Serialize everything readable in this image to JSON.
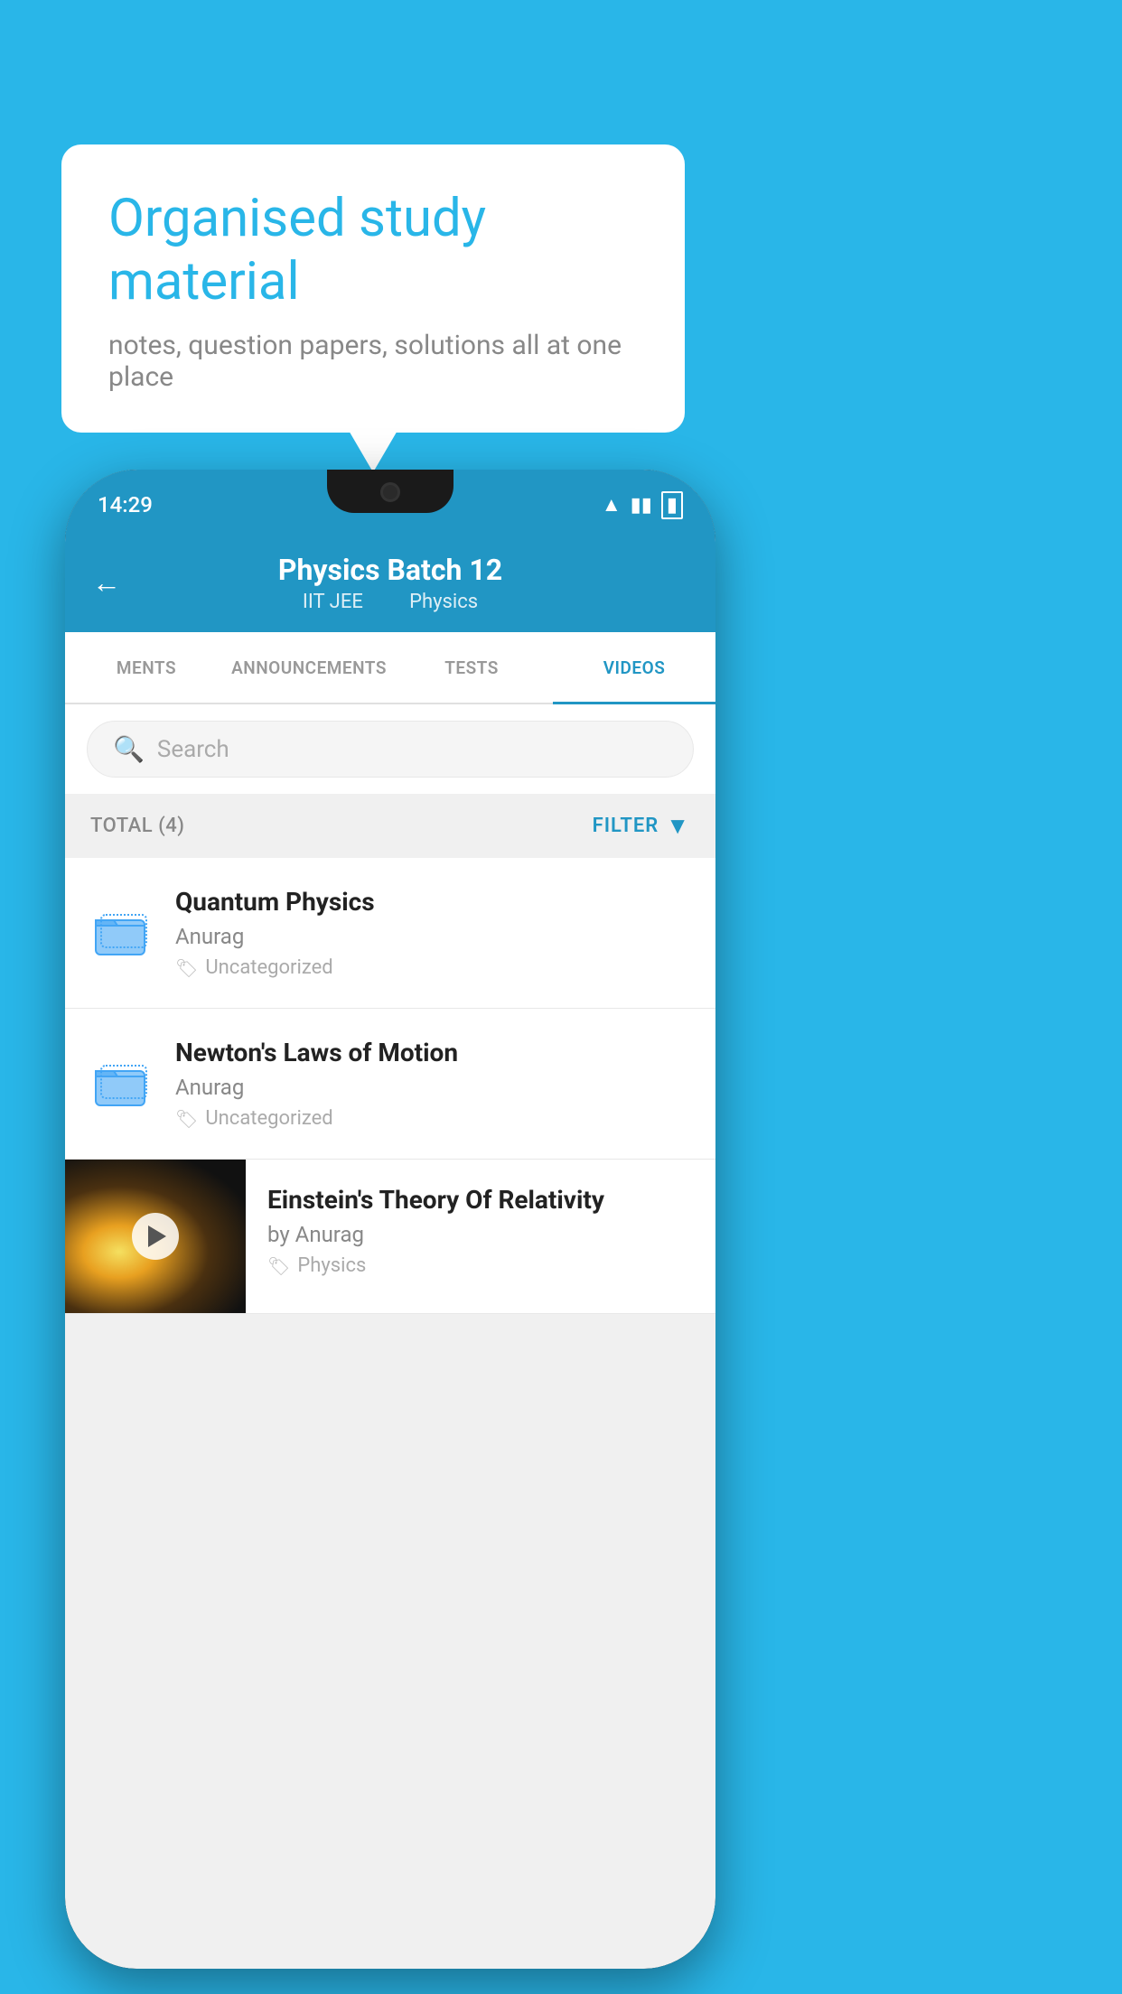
{
  "app": {
    "background_color": "#29b6e8"
  },
  "bubble": {
    "title": "Organised study material",
    "subtitle": "notes, question papers, solutions all at one place"
  },
  "status_bar": {
    "time": "14:29",
    "wifi": "▾",
    "signal": "▴",
    "battery": "▮"
  },
  "header": {
    "title": "Physics Batch 12",
    "subtitle1": "IIT JEE",
    "subtitle2": "Physics",
    "back_label": "←"
  },
  "tabs": [
    {
      "label": "MENTS",
      "active": false
    },
    {
      "label": "ANNOUNCEMENTS",
      "active": false
    },
    {
      "label": "TESTS",
      "active": false
    },
    {
      "label": "VIDEOS",
      "active": true
    }
  ],
  "search": {
    "placeholder": "Search"
  },
  "filter": {
    "total_label": "TOTAL (4)",
    "filter_label": "FILTER"
  },
  "videos": [
    {
      "title": "Quantum Physics",
      "author": "Anurag",
      "tag": "Uncategorized",
      "has_thumbnail": false
    },
    {
      "title": "Newton's Laws of Motion",
      "author": "Anurag",
      "tag": "Uncategorized",
      "has_thumbnail": false
    },
    {
      "title": "Einstein's Theory Of Relativity",
      "author": "by Anurag",
      "tag": "Physics",
      "has_thumbnail": true
    }
  ]
}
